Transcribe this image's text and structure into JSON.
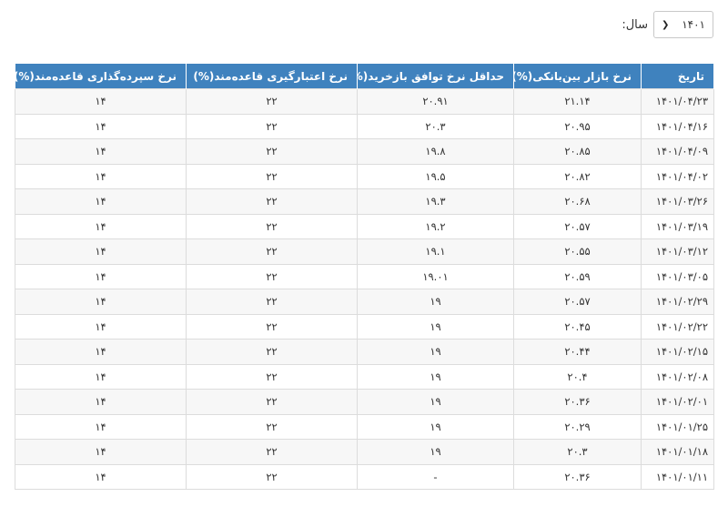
{
  "filter": {
    "year_label": "سال:",
    "year_value": "۱۴۰۱"
  },
  "table": {
    "headers": {
      "date": "تاریخ",
      "interbank": "نرخ بازار بین‌بانکی(%)",
      "repo_min": "حداقل نرخ توافق بازخرید(%)",
      "credit": "نرخ اعتبارگیری قاعده‌مند(%)",
      "deposit": "نرخ سپرده‌گذاری قاعده‌مند(%)"
    },
    "rows": [
      {
        "date": "۱۴۰۱/۰۴/۲۳",
        "interbank": "۲۱.۱۴",
        "repo_min": "۲۰.۹۱",
        "credit": "۲۲",
        "deposit": "۱۴"
      },
      {
        "date": "۱۴۰۱/۰۴/۱۶",
        "interbank": "۲۰.۹۵",
        "repo_min": "۲۰.۳",
        "credit": "۲۲",
        "deposit": "۱۴"
      },
      {
        "date": "۱۴۰۱/۰۴/۰۹",
        "interbank": "۲۰.۸۵",
        "repo_min": "۱۹.۸",
        "credit": "۲۲",
        "deposit": "۱۴"
      },
      {
        "date": "۱۴۰۱/۰۴/۰۲",
        "interbank": "۲۰.۸۲",
        "repo_min": "۱۹.۵",
        "credit": "۲۲",
        "deposit": "۱۴"
      },
      {
        "date": "۱۴۰۱/۰۳/۲۶",
        "interbank": "۲۰.۶۸",
        "repo_min": "۱۹.۳",
        "credit": "۲۲",
        "deposit": "۱۴"
      },
      {
        "date": "۱۴۰۱/۰۳/۱۹",
        "interbank": "۲۰.۵۷",
        "repo_min": "۱۹.۲",
        "credit": "۲۲",
        "deposit": "۱۴"
      },
      {
        "date": "۱۴۰۱/۰۳/۱۲",
        "interbank": "۲۰.۵۵",
        "repo_min": "۱۹.۱",
        "credit": "۲۲",
        "deposit": "۱۴"
      },
      {
        "date": "۱۴۰۱/۰۳/۰۵",
        "interbank": "۲۰.۵۹",
        "repo_min": "۱۹.۰۱",
        "credit": "۲۲",
        "deposit": "۱۴"
      },
      {
        "date": "۱۴۰۱/۰۲/۲۹",
        "interbank": "۲۰.۵۷",
        "repo_min": "۱۹",
        "credit": "۲۲",
        "deposit": "۱۴"
      },
      {
        "date": "۱۴۰۱/۰۲/۲۲",
        "interbank": "۲۰.۴۵",
        "repo_min": "۱۹",
        "credit": "۲۲",
        "deposit": "۱۴"
      },
      {
        "date": "۱۴۰۱/۰۲/۱۵",
        "interbank": "۲۰.۴۴",
        "repo_min": "۱۹",
        "credit": "۲۲",
        "deposit": "۱۴"
      },
      {
        "date": "۱۴۰۱/۰۲/۰۸",
        "interbank": "۲۰.۴",
        "repo_min": "۱۹",
        "credit": "۲۲",
        "deposit": "۱۴"
      },
      {
        "date": "۱۴۰۱/۰۲/۰۱",
        "interbank": "۲۰.۳۶",
        "repo_min": "۱۹",
        "credit": "۲۲",
        "deposit": "۱۴"
      },
      {
        "date": "۱۴۰۱/۰۱/۲۵",
        "interbank": "۲۰.۲۹",
        "repo_min": "۱۹",
        "credit": "۲۲",
        "deposit": "۱۴"
      },
      {
        "date": "۱۴۰۱/۰۱/۱۸",
        "interbank": "۲۰.۳",
        "repo_min": "۱۹",
        "credit": "۲۲",
        "deposit": "۱۴"
      },
      {
        "date": "۱۴۰۱/۰۱/۱۱",
        "interbank": "۲۰.۳۶",
        "repo_min": "-",
        "credit": "۲۲",
        "deposit": "۱۴"
      }
    ]
  }
}
